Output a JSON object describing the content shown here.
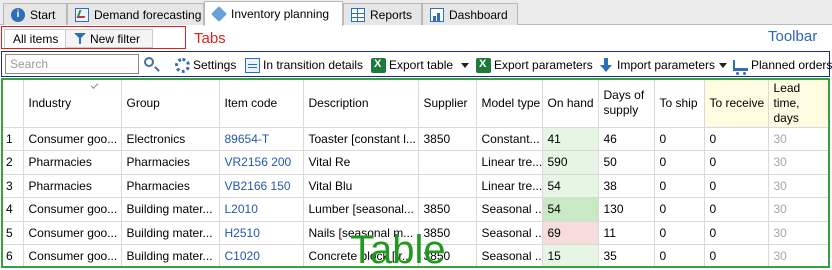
{
  "top_tabs": [
    {
      "label": "Start",
      "icon": "start-icon"
    },
    {
      "label": "Demand forecasting",
      "icon": "chart-icon"
    },
    {
      "label": "Inventory planning",
      "icon": "inventory-icon",
      "active": true
    },
    {
      "label": "Reports",
      "icon": "grid-icon"
    },
    {
      "label": "Dashboard",
      "icon": "dashboard-icon"
    }
  ],
  "sub_tabs": [
    {
      "label": "All items",
      "active": true
    },
    {
      "label": "New filter",
      "icon": "filter-icon"
    }
  ],
  "annotations": {
    "tabs": "Tabs",
    "toolbar": "Toolbar",
    "table": "Table"
  },
  "toolbar": {
    "search_placeholder": "Search",
    "settings": "Settings",
    "in_transition": "In transition details",
    "export_table": "Export table",
    "export_parameters": "Export parameters",
    "import_parameters": "Import parameters",
    "planned_orders": "Planned orders"
  },
  "table": {
    "columns": [
      "",
      "Industry",
      "Group",
      "Item code",
      "Description",
      "Supplier",
      "Model type",
      "On hand",
      "Days of supply",
      "To ship",
      "To receive",
      "Lead time, days"
    ],
    "rows": [
      {
        "idx": "1",
        "industry": "Consumer goo...",
        "group": "Electronics",
        "item_code": "89654-T",
        "description": "Toaster [constant l...",
        "supplier": "3850",
        "model_type": "Constant...",
        "on_hand": "41",
        "days_of_supply": "46",
        "to_ship": "0",
        "to_receive": "0",
        "lead_time": "30"
      },
      {
        "idx": "2",
        "industry": "Pharmacies",
        "group": "Pharmacies",
        "item_code": "VR2156 200",
        "description": "Vital Re",
        "supplier": "",
        "model_type": "Linear tre...",
        "on_hand": "590",
        "days_of_supply": "50",
        "to_ship": "0",
        "to_receive": "0",
        "lead_time": "30"
      },
      {
        "idx": "3",
        "industry": "Pharmacies",
        "group": "Pharmacies",
        "item_code": "VB2166 150",
        "description": "Vital Blu",
        "supplier": "",
        "model_type": "Linear tre...",
        "on_hand": "54",
        "days_of_supply": "38",
        "to_ship": "0",
        "to_receive": "0",
        "lead_time": "30"
      },
      {
        "idx": "4",
        "industry": "Consumer goo...",
        "group": "Building mater...",
        "item_code": "L2010",
        "description": "Lumber  [seasonal...",
        "supplier": "3850",
        "model_type": "Seasonal ...",
        "on_hand": "54",
        "days_of_supply": "130",
        "to_ship": "0",
        "to_receive": "0",
        "lead_time": "30"
      },
      {
        "idx": "5",
        "industry": "Consumer goo...",
        "group": "Building mater...",
        "item_code": "H2510",
        "description": "Nails [seasonal m...",
        "supplier": "3850",
        "model_type": "Seasonal ...",
        "on_hand": "69",
        "days_of_supply": "11",
        "to_ship": "0",
        "to_receive": "0",
        "lead_time": "30"
      },
      {
        "idx": "6",
        "industry": "Consumer goo...",
        "group": "Building mater...",
        "item_code": "C1020",
        "description": "Concrete block [tr...",
        "supplier": "3850",
        "model_type": "Seasonal ...",
        "on_hand": "15",
        "days_of_supply": "35",
        "to_ship": "0",
        "to_receive": "0",
        "lead_time": "30"
      }
    ]
  },
  "colors": {
    "tabs_annotation": "#e02020",
    "toolbar_annotation": "#2a63c9",
    "table_annotation": "#1f9a1f",
    "link": "#2457b0",
    "on_hand_light_green": "#e6f5e4",
    "on_hand_green": "#c9e9c5",
    "on_hand_red": "#f7dcdc",
    "to_receive_bg": "#fdfbe0"
  }
}
